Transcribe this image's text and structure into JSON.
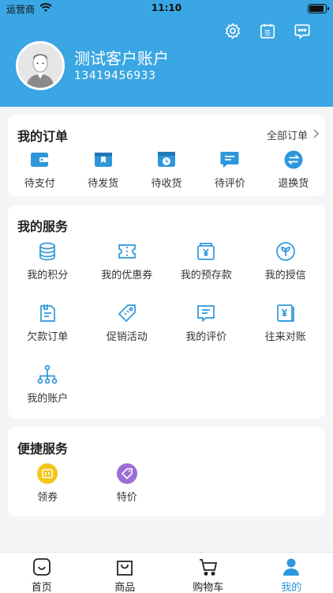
{
  "status_bar": {
    "carrier": "运营商",
    "time": "11:10"
  },
  "header": {
    "user_name": "测试客户账户",
    "phone": "13419456933"
  },
  "orders": {
    "title": "我的订单",
    "all_label": "全部订单",
    "items": [
      {
        "label": "待支付",
        "icon": "wallet-icon"
      },
      {
        "label": "待发货",
        "icon": "package-icon"
      },
      {
        "label": "待收货",
        "icon": "truck-clock-icon"
      },
      {
        "label": "待评价",
        "icon": "comment-icon"
      },
      {
        "label": "退换货",
        "icon": "exchange-icon"
      }
    ]
  },
  "services": {
    "title": "我的服务",
    "items": [
      {
        "label": "我的积分",
        "icon": "coins-icon"
      },
      {
        "label": "我的优惠券",
        "icon": "coupon-icon"
      },
      {
        "label": "我的预存款",
        "icon": "deposit-icon"
      },
      {
        "label": "我的授信",
        "icon": "sprout-icon"
      },
      {
        "label": "欠款订单",
        "icon": "debt-order-icon"
      },
      {
        "label": "促销活动",
        "icon": "tag-icon"
      },
      {
        "label": "我的评价",
        "icon": "review-icon"
      },
      {
        "label": "往来对账",
        "icon": "ledger-icon"
      },
      {
        "label": "我的账户",
        "icon": "org-tree-icon"
      }
    ]
  },
  "quick": {
    "title": "便捷服务",
    "items": [
      {
        "label": "领券",
        "icon": "get-coupon-icon",
        "color": "#f5c518"
      },
      {
        "label": "特价",
        "icon": "special-price-icon",
        "color": "#9b6fd6"
      }
    ]
  },
  "tabbar": {
    "items": [
      {
        "label": "首页",
        "icon": "home-icon"
      },
      {
        "label": "商品",
        "icon": "shopping-bag-icon"
      },
      {
        "label": "购物车",
        "icon": "cart-icon"
      },
      {
        "label": "我的",
        "icon": "user-icon"
      }
    ],
    "active": 3
  },
  "colors": {
    "primary": "#3aa6e3",
    "icon_blue": "#2e97dc",
    "background": "#f4f5f7"
  }
}
